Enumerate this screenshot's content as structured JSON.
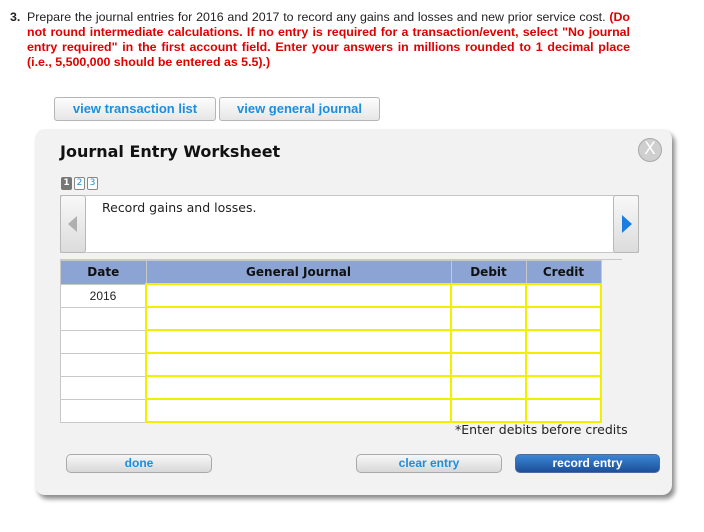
{
  "question": {
    "number": "3.",
    "text": "Prepare the journal entries for 2016 and 2017 to record any gains and losses and new prior service cost.",
    "instructions": "(Do not round intermediate calculations. If no entry is required for a transaction/event, select \"No journal entry required\" in the first account field. Enter your answers in millions rounded to 1 decimal place (i.e., 5,500,000 should be entered as 5.5).)"
  },
  "top_buttons": {
    "view_transaction_list": "view transaction list",
    "view_general_journal": "view general journal"
  },
  "worksheet": {
    "title": "Journal Entry Worksheet",
    "close_icon": "X",
    "pages": [
      "1",
      "2",
      "3"
    ],
    "active_page": 1,
    "description": "Record gains and losses.",
    "columns": [
      "Date",
      "General Journal",
      "Debit",
      "Credit"
    ],
    "rows": [
      {
        "date": "2016",
        "account": "",
        "debit": "",
        "credit": ""
      },
      {
        "date": "",
        "account": "",
        "debit": "",
        "credit": ""
      },
      {
        "date": "",
        "account": "",
        "debit": "",
        "credit": ""
      },
      {
        "date": "",
        "account": "",
        "debit": "",
        "credit": ""
      },
      {
        "date": "",
        "account": "",
        "debit": "",
        "credit": ""
      },
      {
        "date": "",
        "account": "",
        "debit": "",
        "credit": ""
      }
    ],
    "note": "*Enter debits before credits",
    "buttons": {
      "done": "done",
      "clear_entry": "clear entry",
      "record_entry": "record entry"
    }
  },
  "colors": {
    "instruction_red": "#e00000",
    "link_blue": "#1a8fe0",
    "header_blue": "#8ba4d4",
    "input_highlight": "#f0f000",
    "primary_button": "#1d4f99"
  }
}
